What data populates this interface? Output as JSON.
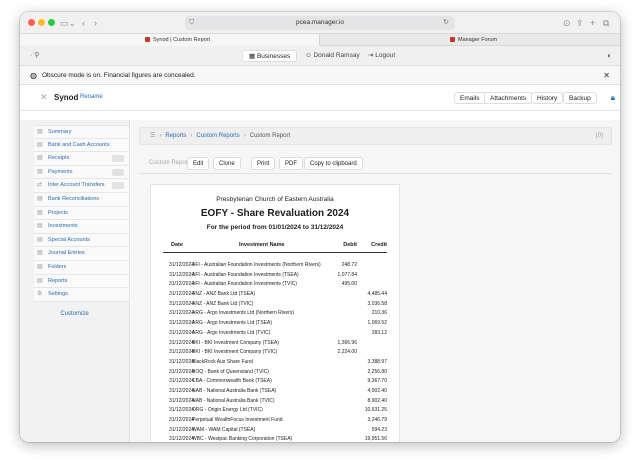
{
  "browser": {
    "url": "pcea.manager.io",
    "tabs": [
      {
        "title": "Synod | Custom Report"
      },
      {
        "title": "Manager Forum"
      }
    ]
  },
  "appbar": {
    "businesses": "Businesses",
    "user": "Donald Ramsay",
    "logout": "Logout"
  },
  "notice": "Obscure mode is on. Financial figures are concealed.",
  "business": {
    "name": "Synod",
    "rename": "Rename",
    "buttons": [
      "Emails",
      "Attachments",
      "History",
      "Backup"
    ]
  },
  "sidebar": {
    "items": [
      {
        "label": "Summary"
      },
      {
        "label": "Bank and Cash Accounts"
      },
      {
        "label": "Receipts"
      },
      {
        "label": "Payments"
      },
      {
        "label": "Inter Account Transfers"
      },
      {
        "label": "Bank Reconciliations"
      },
      {
        "label": "Projects"
      },
      {
        "label": "Investments"
      },
      {
        "label": "Special Accounts"
      },
      {
        "label": "Journal Entries"
      },
      {
        "label": "Folders"
      },
      {
        "label": "Reports"
      },
      {
        "label": "Settings"
      }
    ],
    "customize": "Customize"
  },
  "breadcrumb": {
    "items": [
      "Reports",
      "Custom Reports",
      "Custom Report"
    ],
    "count": "(0)"
  },
  "toolbar": {
    "label": "Custom Report",
    "edit": "Edit",
    "clone": "Clone",
    "print": "Print",
    "pdf": "PDF",
    "copy": "Copy to clipboard"
  },
  "report": {
    "organization": "Presbyterian Church of Eastern Australia",
    "title": "EOFY - Share Revaluation 2024",
    "period": "For the period from 01/01/2024 to 31/12/2024",
    "columns": [
      "Date",
      "Investment Name",
      "Debit",
      "Credit"
    ],
    "rows": [
      [
        "31/12/2024",
        "AFI - Australian Foundation Investments (Northern Rivers)",
        "248.72",
        ""
      ],
      [
        "31/12/2024",
        "AFI - Australian Foundation Investments (TSEA)",
        "1,077.84",
        ""
      ],
      [
        "31/12/2024",
        "AFI - Australian Foundation Investments (TVIC)",
        "495.00",
        ""
      ],
      [
        "31/12/2024",
        "ANZ - ANZ Bank Ltd (TSEA)",
        "",
        "4,485.44"
      ],
      [
        "31/12/2024",
        "ANZ - ANZ Bank Ltd (TVIC)",
        "",
        "3,036.58"
      ],
      [
        "31/12/2024",
        "ARG - Argo Investments Ltd (Northern Rivers)",
        "",
        "210.36"
      ],
      [
        "31/12/2024",
        "ARG - Argo Investments Ltd (TSEA)",
        "",
        "1,069.52"
      ],
      [
        "31/12/2024",
        "ARG - Argo Investments Ltd (TVIC)",
        "",
        "283.12"
      ],
      [
        "31/12/2024",
        "BKI - BKI Investment Company (TSEA)",
        "1,366.96",
        ""
      ],
      [
        "31/12/2024",
        "BKI - BKI Investment Company (TVIC)",
        "2,224.00",
        ""
      ],
      [
        "31/12/2024",
        "BlackRock Aus Share Fund",
        "",
        "3,388.97"
      ],
      [
        "31/12/2024",
        "BOQ - Bank of Queensland (TVIC)",
        "",
        "2,256.80"
      ],
      [
        "31/12/2024",
        "CBA - Commonwealth Bank (TSEA)",
        "",
        "9,367.70"
      ],
      [
        "31/12/2024",
        "NAB - National Australia Bank (TSEA)",
        "",
        "4,902.40"
      ],
      [
        "31/12/2024",
        "NAB - National Australia Bank (TVIC)",
        "",
        "8,902.40"
      ],
      [
        "31/12/2024",
        "ORG - Origin Energy Ltd (TVIC)",
        "",
        "10,631.25"
      ],
      [
        "31/12/2024",
        "Perpetual WealthFocus Investment Fund",
        "",
        "3,246.79"
      ],
      [
        "31/12/2024",
        "WAM - WAM Capital (TSEA)",
        "",
        "594.23"
      ],
      [
        "31/12/2024",
        "WBC - Westpac Banking Corporation (TSEA)",
        "",
        "19,951.56"
      ]
    ]
  }
}
